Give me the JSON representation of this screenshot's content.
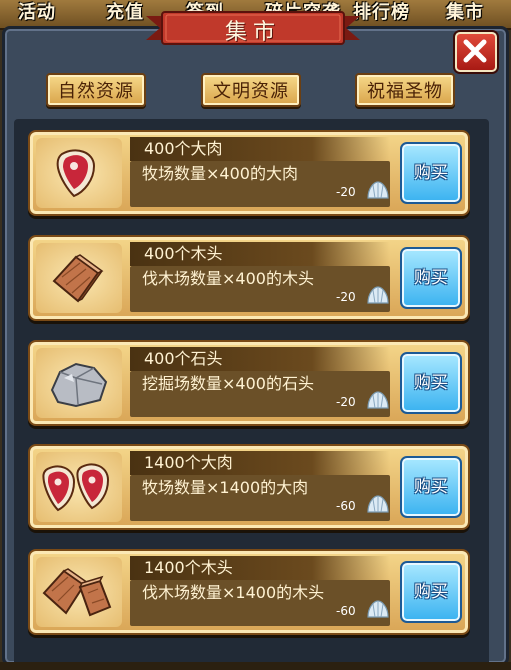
{
  "top_tabs": [
    "活动",
    "充值",
    "签到",
    "碎片突袭",
    "排行榜",
    "集市"
  ],
  "title": "集市",
  "categories": [
    "自然资源",
    "文明资源",
    "祝福圣物"
  ],
  "items": [
    {
      "name": "400个大肉",
      "desc": "牧场数量×400的大肉",
      "cost": "-20",
      "buy": "购买",
      "icon": "meat-icon"
    },
    {
      "name": "400个木头",
      "desc": "伐木场数量×400的木头",
      "cost": "-20",
      "buy": "购买",
      "icon": "wood-icon"
    },
    {
      "name": "400个石头",
      "desc": "挖掘场数量×400的石头",
      "cost": "-20",
      "buy": "购买",
      "icon": "stone-icon"
    },
    {
      "name": "1400个大肉",
      "desc": "牧场数量×1400的大肉",
      "cost": "-60",
      "buy": "购买",
      "icon": "meat-double-icon"
    },
    {
      "name": "1400个木头",
      "desc": "伐木场数量×1400的木头",
      "cost": "-60",
      "buy": "购买",
      "icon": "wood-double-icon"
    }
  ],
  "colors": {
    "accent_red": "#c0392b",
    "buy_blue": "#3ab2f0",
    "row_gold": "#e6bd70",
    "panel": "#3c4a5c"
  }
}
